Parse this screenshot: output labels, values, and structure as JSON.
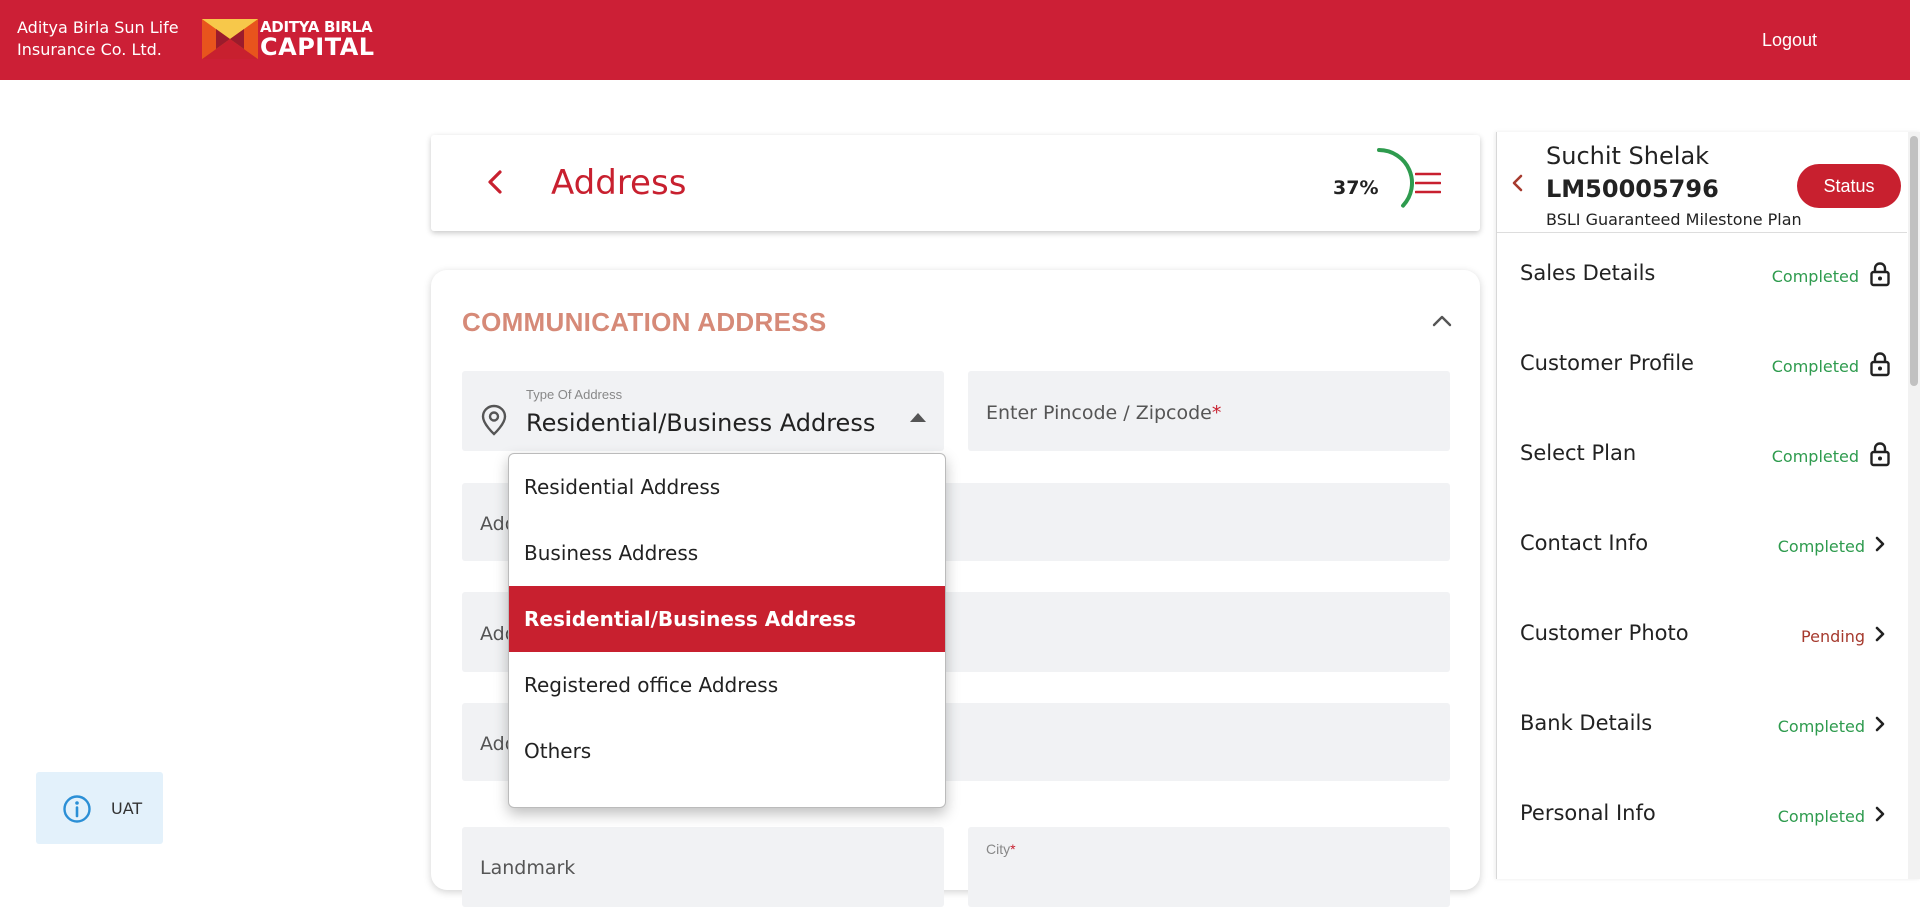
{
  "topbar": {
    "brand_line1": "Aditya Birla Sun Life",
    "brand_line2": "Insurance Co. Ltd.",
    "logo_line1": "ADITYA BIRLA",
    "logo_line2": "CAPITAL",
    "logout_label": "Logout",
    "brand_color": "#cc1f36"
  },
  "header": {
    "title": "Address",
    "progress_text": "37%",
    "progress_value": 0.37
  },
  "section": {
    "title": "COMMUNICATION ADDRESS"
  },
  "form": {
    "type_of_address_label": "Type Of Address",
    "type_of_address_value": "Residential/Business Address",
    "pincode_placeholder": "Enter Pincode / Zipcode",
    "required_mark": "*",
    "address1_placeholder": "Add",
    "address2_placeholder": "Add",
    "address3_placeholder": "Add",
    "landmark_placeholder": "Landmark",
    "city_label": "City"
  },
  "dropdown": {
    "options": [
      "Residential Address",
      "Business Address",
      "Residential/Business Address",
      "Registered office Address",
      "Others"
    ],
    "selected_index": 2
  },
  "env_badge": {
    "label": "UAT"
  },
  "customer": {
    "name": "Suchit Shelak",
    "id": "LM50005796",
    "plan": "BSLI Guaranteed Milestone Plan",
    "status_button": "Status"
  },
  "steps": [
    {
      "name": "Sales Details",
      "status": "Completed",
      "icon": "lock-icon"
    },
    {
      "name": "Customer Profile",
      "status": "Completed",
      "icon": "lock-icon"
    },
    {
      "name": "Select Plan",
      "status": "Completed",
      "icon": "lock-icon"
    },
    {
      "name": "Contact Info",
      "status": "Completed",
      "icon": "chevron-right-icon"
    },
    {
      "name": "Customer Photo",
      "status": "Pending",
      "icon": "chevron-right-icon"
    },
    {
      "name": "Bank Details",
      "status": "Completed",
      "icon": "chevron-right-icon"
    },
    {
      "name": "Personal Info",
      "status": "Completed",
      "icon": "chevron-right-icon"
    }
  ],
  "colors": {
    "accent": "#c8202f",
    "completed": "#2e9b4e",
    "pending": "#a63a2e",
    "progress_ring": "#2e9b4e"
  }
}
